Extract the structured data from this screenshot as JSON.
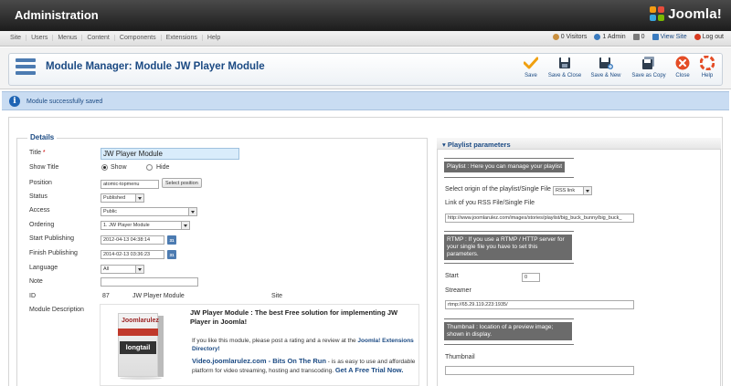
{
  "header": {
    "title": "Administration",
    "logo_text": "Joomla!"
  },
  "menu": {
    "items": [
      "Site",
      "Users",
      "Menus",
      "Content",
      "Components",
      "Extensions",
      "Help"
    ]
  },
  "status": {
    "visitors": "0 Visitors",
    "admins": "1 Admin",
    "messages": "0",
    "view_site": "View Site",
    "logout": "Log out"
  },
  "toolbar": {
    "title": "Module Manager: Module JW Player Module",
    "buttons": [
      "Save",
      "Save & Close",
      "Save & New",
      "Save as Copy",
      "Close",
      "Help"
    ]
  },
  "message": "Module successfully saved",
  "details": {
    "legend": "Details",
    "title_label": "Title",
    "title_value": "JW Player Module",
    "show_title_label": "Show Title",
    "show_label": "Show",
    "hide_label": "Hide",
    "position_label": "Position",
    "position_value": "atomic-topmenu",
    "select_position": "Select position",
    "status_label": "Status",
    "status_value": "Published",
    "access_label": "Access",
    "access_value": "Public",
    "ordering_label": "Ordering",
    "ordering_value": "1. JW Player Module",
    "start_label": "Start Publishing",
    "start_value": "2012-04-13 04:38:14",
    "finish_label": "Finish Publishing",
    "finish_value": "2014-02-13 03:36:23",
    "language_label": "Language",
    "language_value": "All",
    "note_label": "Note",
    "id_label": "ID",
    "id_value": "87",
    "module_name": "JW Player Module",
    "client": "Site",
    "description_label": "Module Description",
    "calendar_glyph": "31"
  },
  "description": {
    "box_brand": "Joomlarulez",
    "box_product": "longtail",
    "head": "JW Player Module : The best Free solution for implementing JW Player in Joomla!",
    "p1_pre": "If you like this module, please post a rating and a review at the",
    "p1_link": "Joomla! Extensions Directory!",
    "p2_link": "Video.joomlarulez.com - Bits On The Run",
    "p2_mid": " - is as easy to use and affordable platform for video streaming, hosting and transcoding.",
    "p2_link2": "Get A Free Trial Now."
  },
  "playlist": {
    "header": "Playlist parameters",
    "note1": "Playlist : Here you can manage your playlist",
    "origin_label": "Select origin of the playlist/Single File",
    "origin_value": "RSS link",
    "rss_label": "Link of you RSS File/Single File",
    "rss_value": "http://www.joomlarulez.com/images/stories/playlist/big_buck_bunny/big_buck_",
    "note2": "RTMP : If you use a RTMP / HTTP server for your single file you have to set this parameters.",
    "start_label": "Start",
    "start_value": "0",
    "streamer_label": "Streamer",
    "streamer_value": "rtmp://65.29.119.223:1935/",
    "note3": "Thumbnail : location of a preview image; shown in display.",
    "thumbnail_label": "Thumbnail"
  },
  "colors": {
    "accent": "#1b4a83",
    "message_bg": "#c9dcf2",
    "note_bg": "#6b6b6b"
  }
}
